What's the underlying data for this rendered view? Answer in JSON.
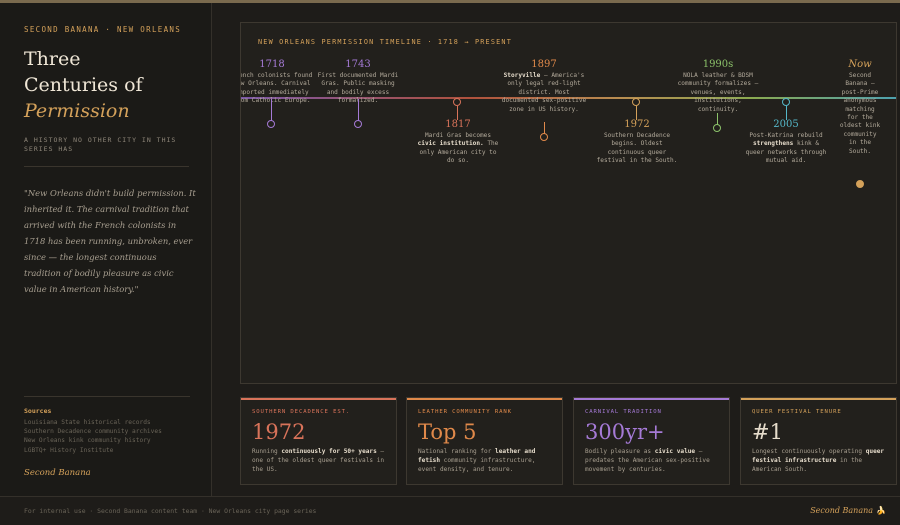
{
  "sidebar": {
    "kicker": "Second Banana · New Orleans",
    "title_line1": "Three",
    "title_line2": "Centuries of",
    "title_em": "Permission",
    "subtitle": "A history no other city in this series has",
    "quote": "\"New Orleans didn't build permission. It inherited it. The carnival tradition that arrived with the French colonists in 1718 has been running, unbroken, ever since — the longest continuous tradition of bodily pleasure as civic value in American history.\"",
    "sources_heading": "Sources",
    "sources": [
      "Louisiana State historical records",
      "Southern Decadence community archives",
      "New Orleans kink community history",
      "LGBTQ+ History Institute"
    ],
    "signature": "Second Banana"
  },
  "timeline": {
    "title": "New Orleans permission timeline · 1718 → present",
    "events": [
      {
        "year": "1718",
        "pre": "French colonists found New Orleans. Carnival imported immediately from Catholic Europe.",
        "bold": "",
        "post": ""
      },
      {
        "year": "1743",
        "pre": "First documented Mardi Gras. Public masking and bodily excess formalized.",
        "bold": "",
        "post": ""
      },
      {
        "year": "1817",
        "pre": "Mardi Gras becomes ",
        "bold": "civic institution.",
        "post": " The only American city to do so."
      },
      {
        "year": "1897",
        "pre": "",
        "bold": "Storyville",
        "post": " — America's only legal red-light district. Most documented sex-positive zone in US history."
      },
      {
        "year": "1972",
        "pre": "Southern Decadence begins. Oldest continuous queer festival in the South.",
        "bold": "",
        "post": ""
      },
      {
        "year": "1990s",
        "pre": "",
        "bold": "",
        "post": "NOLA leather & BDSM community formalizes — venues, events, institutions, continuity."
      },
      {
        "year": "2005",
        "pre": "Post-Katrina rebuild ",
        "bold": "strengthens",
        "post": " kink & queer networks through mutual aid."
      },
      {
        "year": "Now",
        "pre": "Second Banana — post-Prime anonymous matching for the oldest kink community in the South.",
        "bold": "",
        "post": ""
      }
    ]
  },
  "stats": [
    {
      "label": "Southern Decadence est.",
      "value": "1972",
      "pre": "Running ",
      "bold": "continuously for 50+ years",
      "post": " — one of the oldest queer festivals in the US.",
      "color": "#d9735a"
    },
    {
      "label": "Leather community rank",
      "value": "Top 5",
      "pre": "National ranking for ",
      "bold": "leather and fetish",
      "post": " community infrastructure, event density, and tenure.",
      "color": "#e0894a"
    },
    {
      "label": "Carnival tradition",
      "value": "300yr+",
      "pre": "Bodily pleasure as ",
      "bold": "civic value",
      "post": " — predates the American sex-positive movement by centuries.",
      "color": "#a57ad6"
    },
    {
      "label": "Queer festival tenure",
      "value": "#1",
      "pre": "Longest continuously operating ",
      "bold": "queer festival infrastructure",
      "post": " in the American South.",
      "color": "#d4a15a"
    }
  ],
  "footer": {
    "text": "For internal use · Second Banana content team · New Orleans city page series",
    "brand": "Second Banana",
    "brand_icon": "banana-icon"
  },
  "colors": {
    "accent": "#d4a15a",
    "purple": "#a57ad6",
    "red": "#d9735a",
    "orange": "#e0894a",
    "green": "#8cc26a",
    "cyan": "#55b8c9"
  }
}
